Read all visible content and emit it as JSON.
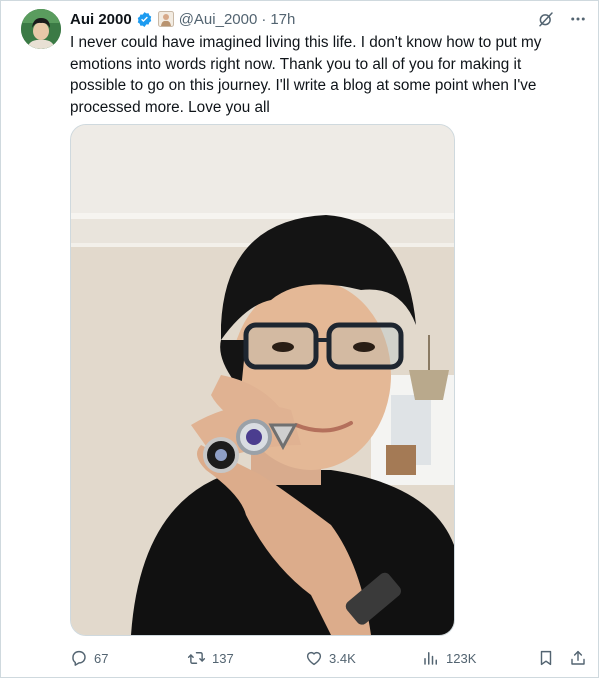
{
  "tweet": {
    "author": {
      "display_name": "Aui 2000",
      "handle": "@Aui_2000",
      "verified": true
    },
    "separator": "·",
    "time": "17h",
    "text": "I never could have imagined living this life. I don't know how to put my emotions into words right now. Thank you to all of you for making it possible to go on this journey. I'll write a blog at some point when I've processed more. Love you all",
    "media": {
      "kind": "photo",
      "description_icon": "photo-selfie-with-rings"
    }
  },
  "actions": {
    "replies": "67",
    "reposts": "137",
    "likes": "3.4K",
    "views": "123K"
  },
  "colors": {
    "text": "#0f1419",
    "secondary": "#536471",
    "verified": "#1d9bf0",
    "border": "#cfd9de"
  }
}
